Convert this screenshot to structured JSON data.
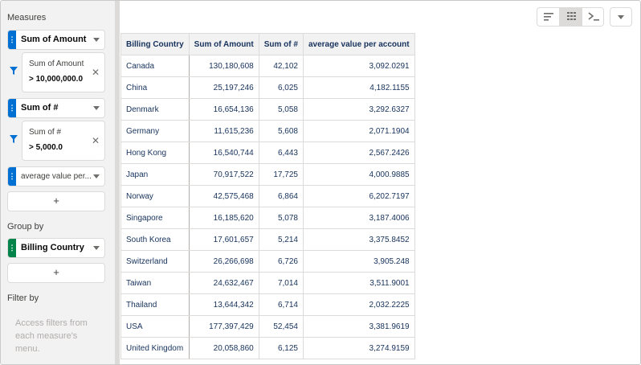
{
  "sidebar": {
    "measures_title": "Measures",
    "measures": [
      {
        "label": "Sum of Amount",
        "filter": {
          "name": "Sum of Amount",
          "value": "> 10,000,000.0"
        }
      },
      {
        "label": "Sum of #",
        "filter": {
          "name": "Sum of #",
          "value": "> 5,000.0"
        }
      },
      {
        "label": "average value per..."
      }
    ],
    "add_label": "+",
    "group_title": "Group by",
    "group": {
      "label": "Billing Country"
    },
    "group_add_label": "+",
    "filter_title": "Filter by",
    "filter_hint": "Access filters from each measure's menu."
  },
  "toolbar": {
    "buttons": [
      {
        "icon": "bar-lines-icon",
        "active": false
      },
      {
        "icon": "table-view-icon",
        "active": true
      },
      {
        "icon": "terminal-icon",
        "active": false
      }
    ],
    "menu_icon": "chevron-down-icon"
  },
  "table": {
    "columns": [
      "Billing Country",
      "Sum of Amount",
      "Sum of #",
      "average value per account"
    ],
    "rows": [
      [
        "Canada",
        "130,180,608",
        "42,102",
        "3,092.0291"
      ],
      [
        "China",
        "25,197,246",
        "6,025",
        "4,182.1155"
      ],
      [
        "Denmark",
        "16,654,136",
        "5,058",
        "3,292.6327"
      ],
      [
        "Germany",
        "11,615,236",
        "5,608",
        "2,071.1904"
      ],
      [
        "Hong Kong",
        "16,540,744",
        "6,443",
        "2,567.2426"
      ],
      [
        "Japan",
        "70,917,522",
        "17,725",
        "4,000.9885"
      ],
      [
        "Norway",
        "42,575,468",
        "6,864",
        "6,202.7197"
      ],
      [
        "Singapore",
        "16,185,620",
        "5,078",
        "3,187.4006"
      ],
      [
        "South Korea",
        "17,601,657",
        "5,214",
        "3,375.8452"
      ],
      [
        "Switzerland",
        "26,266,698",
        "6,726",
        "3,905.248"
      ],
      [
        "Taiwan",
        "24,632,467",
        "7,014",
        "3,511.9001"
      ],
      [
        "Thailand",
        "13,644,342",
        "6,714",
        "2,032.2225"
      ],
      [
        "USA",
        "177,397,429",
        "52,454",
        "3,381.9619"
      ],
      [
        "United Kingdom",
        "20,058,860",
        "6,125",
        "3,274.9159"
      ]
    ]
  },
  "colors": {
    "accent_blue": "#0070d2",
    "accent_green": "#04844b"
  }
}
